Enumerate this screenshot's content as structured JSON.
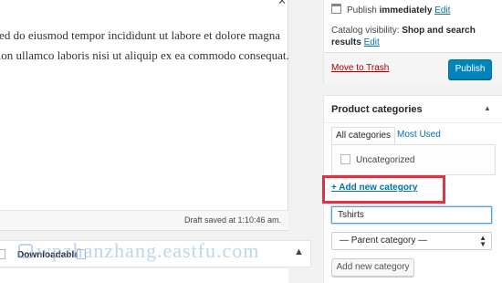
{
  "editor": {
    "line1": "sed do eiusmod tempor incididunt ut labore et dolore magna",
    "line2": "tion ullamco laboris nisi ut aliquip ex ea commodo consequat.",
    "draft_status": "Draft saved at 1:10:46 am."
  },
  "product_data": {
    "downloadable_label": "Downloadable:",
    "watermark": "wpzhanzhang.eastfu.com"
  },
  "publish": {
    "publish_prefix": "Publish",
    "publish_when": "immediately",
    "edit_label": "Edit",
    "catalog_prefix": "Catalog visibility:",
    "catalog_value_line1": "Shop and search",
    "catalog_value_line2": "results",
    "catalog_edit_label": "Edit",
    "trash_label": "Move to Trash",
    "publish_button": "Publish",
    "button_color": "#0085ba"
  },
  "categories": {
    "title": "Product categories",
    "tabs": [
      "All categories",
      "Most Used"
    ],
    "items": [
      {
        "label": "Uncategorized",
        "checked": false
      }
    ],
    "add_new_link": "+ Add new category",
    "new_category_value": "Tshirts",
    "parent_select": "— Parent category —",
    "add_button": "Add new category",
    "highlight_color": "#e03242"
  }
}
